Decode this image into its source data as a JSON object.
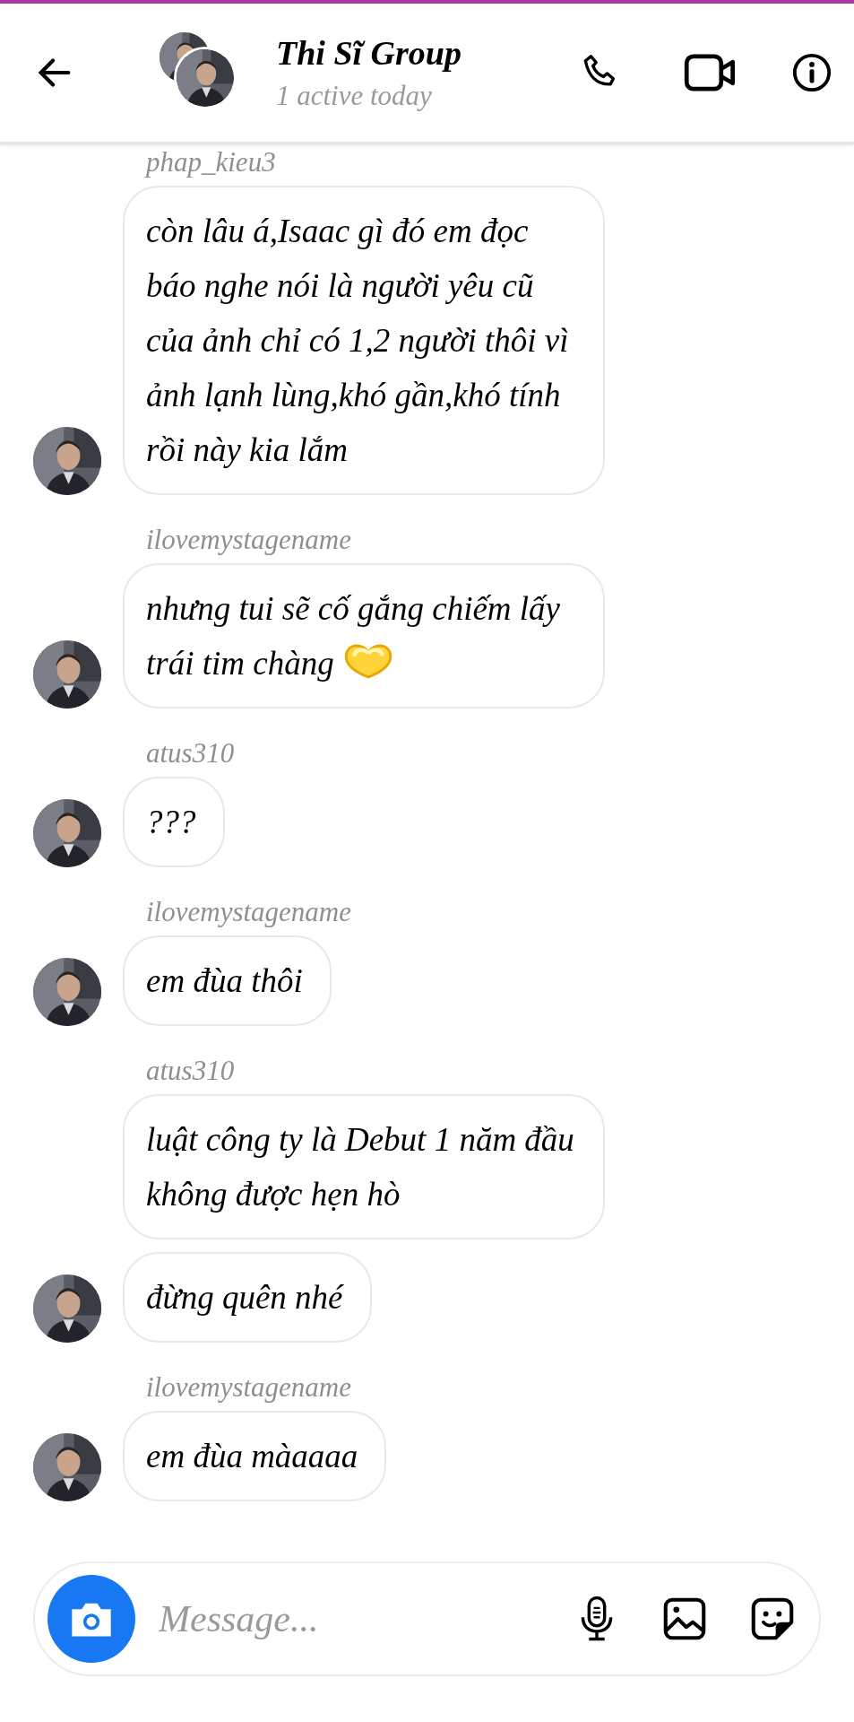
{
  "header": {
    "title": "Thi Sĩ Group",
    "subtitle": "1 active today"
  },
  "groups": [
    {
      "sender": "phap_kieu3",
      "messages": [
        {
          "text": "còn lâu á,Isaac gì đó em đọc báo nghe nói là người yêu cũ của ảnh chỉ có 1,2 người thôi vì ảnh lạnh lùng,khó gần,khó tính rồi này kia lắm"
        }
      ]
    },
    {
      "sender": "ilovemystagename",
      "messages": [
        {
          "text": "nhưng tui sẽ cố gắng chiếm lấy trái tim chàng",
          "kind": "with_emoji"
        }
      ]
    },
    {
      "sender": "atus310",
      "messages": [
        {
          "text": "???"
        }
      ]
    },
    {
      "sender": "ilovemystagename",
      "messages": [
        {
          "text": "em đùa thôi"
        }
      ]
    },
    {
      "sender": "atus310",
      "messages": [
        {
          "text": "luật công ty là Debut 1 năm đầu không được hẹn hò"
        },
        {
          "text": "đừng quên nhé"
        }
      ]
    },
    {
      "sender": "ilovemystagename",
      "messages": [
        {
          "text": "em đùa màaaaa"
        }
      ]
    }
  ],
  "composer": {
    "placeholder": "Message..."
  }
}
